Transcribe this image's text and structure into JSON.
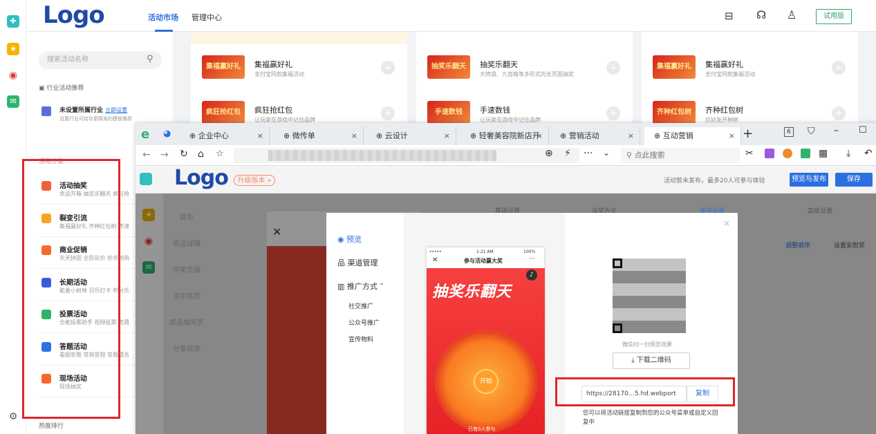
{
  "top": {
    "logo": "Logo",
    "nav": [
      "活动市场",
      "管理中心"
    ],
    "trial": "试用版"
  },
  "sidebar": {
    "search_placeholder": "搜索活动名称",
    "industry_title": "行业活动推荐",
    "industry_name": "未设置所属行业",
    "industry_link": "立即设置",
    "industry_desc": "设置行业可给你更精准的模板推荐",
    "cat_header": "活动分类",
    "categories": [
      {
        "title": "活动抽奖",
        "sub": "幸运开箱 抽奖乐翻天 疯狂抢",
        "color": "#f0613a"
      },
      {
        "title": "裂变引流",
        "sub": "集福赢好礼 齐种红包树 传递",
        "color": "#f5a623"
      },
      {
        "title": "商业促销",
        "sub": "天天拼团 全民砍价 秒杀抢购",
        "color": "#f56a2e"
      },
      {
        "title": "长期活动",
        "sub": "能量小树林 日历打卡 积分乐",
        "color": "#3a5bd9"
      },
      {
        "title": "投票活动",
        "sub": "全能投票助手 视频投票 竞猜",
        "color": "#2fb36a"
      },
      {
        "title": "答题活动",
        "sub": "看图答题 常规答题 答题猜名",
        "color": "#2f6fe0"
      },
      {
        "title": "现场活动",
        "sub": "现场抽奖",
        "color": "#f5682a"
      }
    ],
    "hot": "热度排行"
  },
  "cards": [
    {
      "badge": "集福赢好礼",
      "title": "集福赢好礼",
      "desc": "支付宝同款集福活动"
    },
    {
      "badge": "抽奖乐翻天",
      "title": "抽奖乐翻天",
      "desc": "大转盘、九宫格等多形式的长页面抽奖"
    },
    {
      "badge": "集福赢好礼",
      "title": "集福赢好礼",
      "desc": "支付宝同款集福活动"
    },
    {
      "badge": "疯狂抢红包",
      "title": "疯狂抢红包",
      "desc": "让玩家在游戏中记住品牌"
    },
    {
      "badge": "手速数钱",
      "title": "手速数钱",
      "desc": "让玩家在游戏中记住品牌"
    },
    {
      "badge": "齐种红包树",
      "title": "齐种红包树",
      "desc": "拉好友开种树"
    }
  ],
  "browser": {
    "tabs": [
      "企业中心",
      "微传单",
      "云设计",
      "轻奢美容院新店开",
      "营销活动",
      "互动营销"
    ],
    "search_placeholder": "点此搜索",
    "tab_count": "6"
  },
  "inner": {
    "logo": "Logo",
    "upgrade": "升级版本 »",
    "notice": "活动暂未发布，最多20人可参与体验",
    "publish": "预览与发布",
    "save": "保存",
    "menu": [
      "首页",
      "奖品详情",
      "中奖页面",
      "没中奖页",
      "奖品抽完页",
      "分享效果"
    ],
    "tabs": [
      "基础设置",
      "派奖方式",
      "奖项设置",
      "高级设置"
    ],
    "reorder": "调整顺序",
    "setting": "设置安慰奖",
    "time": "1:21 AM",
    "battery": "100%"
  },
  "modal": {
    "nav": [
      "预览",
      "渠道管理",
      "推广方式"
    ],
    "sub": [
      "社交推广",
      "公众号推广",
      "宣传物料"
    ],
    "phone_time": "1:21 AM",
    "phone_batt": "100%",
    "phone_title": "参与活动赢大奖",
    "poster_title": "抽奖乐翻天",
    "start": "开始",
    "joined": "已有0人参与",
    "qr_caption": "微信扫一扫预览效果",
    "download": "下载二维码",
    "url": "https://28170…5.hd.webport",
    "copy": "复制",
    "hint": "您可以将活动链接复制到您的公众号菜单或自定义回复中"
  }
}
